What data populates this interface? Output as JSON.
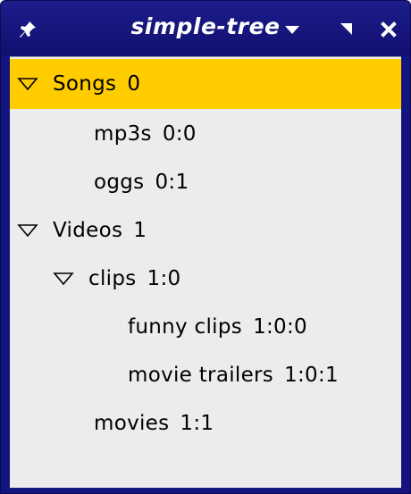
{
  "window": {
    "title": "simple-tree",
    "buttons": {
      "pin": "pin-icon",
      "menu": "menu-down-icon",
      "shade": "shade-icon",
      "close": "close-icon"
    },
    "colors": {
      "titlebar": "#14147e",
      "selection": "#ffcc00",
      "background": "#ececec"
    }
  },
  "tree": {
    "rows": [
      {
        "label": "Songs",
        "path": "0",
        "expanded": true,
        "selected": true
      },
      {
        "label": "mp3s",
        "path": "0:0"
      },
      {
        "label": "oggs",
        "path": "0:1"
      },
      {
        "label": "Videos",
        "path": "1",
        "expanded": true
      },
      {
        "label": "clips",
        "path": "1:0",
        "expanded": true
      },
      {
        "label": "funny clips",
        "path": "1:0:0"
      },
      {
        "label": "movie trailers",
        "path": "1:0:1"
      },
      {
        "label": "movies",
        "path": "1:1"
      }
    ]
  }
}
